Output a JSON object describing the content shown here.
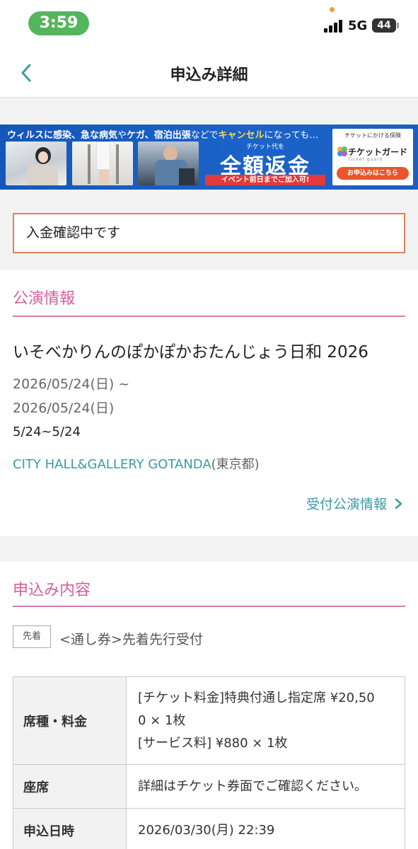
{
  "status_bar": {
    "time": "3:59",
    "network": "5G",
    "battery": "44"
  },
  "header": {
    "title": "申込み詳細"
  },
  "banner": {
    "top_text_1": "ウィルスに感染、急な病気",
    "top_text_2": "や",
    "top_text_3": "ケガ、宿泊出張",
    "top_text_4": "などで",
    "top_text_5": "キャンセル",
    "top_text_6": "になっても…",
    "cta_small": "チケット代を",
    "cta_big": "全額返金",
    "cta_note": "イベント前日までご加入可!",
    "guard_caption": "チケットにかける保険",
    "guard_name": "チケットガード",
    "guard_sub": "Ticket guard",
    "guard_button": "お申込みはこちら"
  },
  "payment_status": "入金確認中です",
  "event_section": {
    "heading": "公演情報",
    "title": "いそべかりんのぽかぽかおたんじょう日和 2026",
    "date_start": "2026/05/24(日) ~",
    "date_end": "2026/05/24(日)",
    "short_date": "5/24~5/24",
    "venue": "CITY HALL&GALLERY GOTANDA",
    "prefecture": "(東京都)",
    "link_label": "受付公演情報"
  },
  "application_section": {
    "heading": "申込み内容",
    "badge": "先着",
    "reception_type": "<通し券>先着先行受付",
    "rows": [
      {
        "label": "席種・料金",
        "value_1": "[チケット料金]特典付通し指定席 ¥20,50",
        "value_2": "0 × 1枚",
        "value_3": "[サービス料] ¥880 × 1枚"
      },
      {
        "label": "座席",
        "value_1": "詳細はチケット券面でご確認ください。"
      },
      {
        "label": "申込日時",
        "value_1": "2026/03/30(月) 22:39"
      }
    ]
  },
  "colors": {
    "accent_pink": "#d4609a",
    "link_teal": "#3d9aa3",
    "status_border": "#e0815e",
    "time_pill": "#54b65a"
  }
}
